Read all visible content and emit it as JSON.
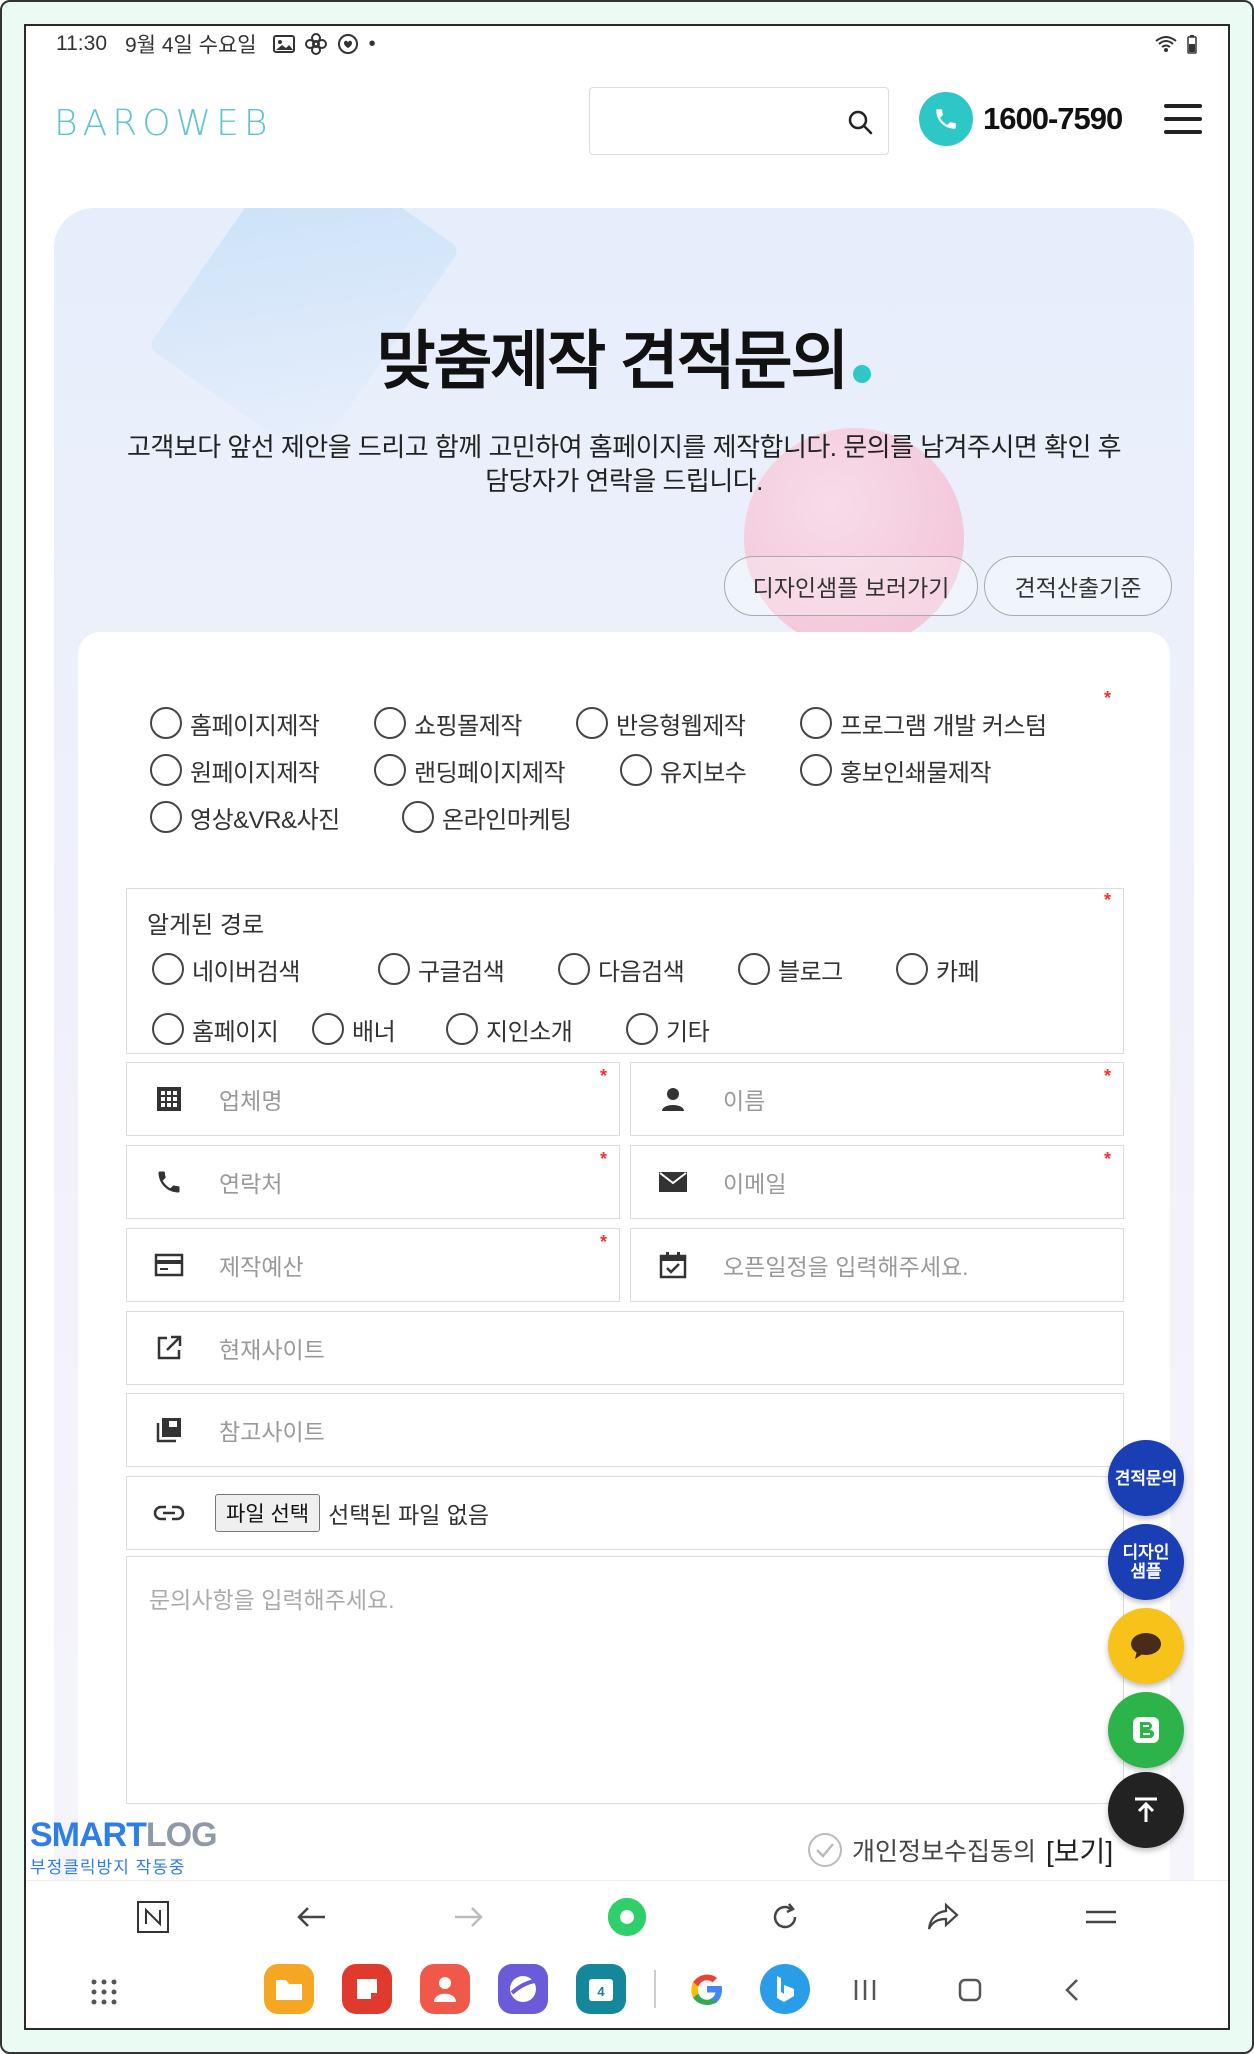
{
  "status_bar": {
    "time": "11:30",
    "date": "9월 4일 수요일",
    "dot": "•"
  },
  "header": {
    "logo": "BAROWEB",
    "phone": "1600-7590"
  },
  "hero": {
    "title": "맞춤제작 견적문의",
    "desc_line1": "고객보다 앞선 제안을 드리고 함께 고민하여 홈페이지를 제작합니다. 문의를 남겨주시면 확인 후",
    "desc_line2": "담당자가 연락을 드립니다.",
    "btn_sample": "디자인샘플 보러가기",
    "btn_criteria": "견적산출기준"
  },
  "form": {
    "required_mark": "*",
    "service_options": [
      "홈페이지제작",
      "쇼핑몰제작",
      "반응형웹제작",
      "프로그램 개발 커스텀",
      "원페이지제작",
      "랜딩페이지제작",
      "유지보수",
      "홍보인쇄물제작",
      "영상&VR&사진",
      "온라인마케팅"
    ],
    "route_title": "알게된 경로",
    "route_options": [
      "네이버검색",
      "구글검색",
      "다음검색",
      "블로그",
      "카페",
      "홈페이지",
      "배너",
      "지인소개",
      "기타"
    ],
    "company_placeholder": "업체명",
    "name_placeholder": "이름",
    "contact_placeholder": "연락처",
    "email_placeholder": "이메일",
    "budget_placeholder": "제작예산",
    "open_date_placeholder": "오픈일정을 입력해주세요.",
    "current_site_placeholder": "현재사이트",
    "reference_site_placeholder": "참고사이트",
    "file_button": "파일 선택",
    "file_status": "선택된 파일 없음",
    "message_placeholder": "문의사항을 입력해주세요.",
    "privacy_label": "개인정보수집동의",
    "privacy_view": "[보기]"
  },
  "fabs": {
    "estimate": "견적문의",
    "design_sample": "디자인\n샘플"
  },
  "smartlog": {
    "title_a": "SMART",
    "title_b": "LOG",
    "subtitle": "부정클릭방지 작동중"
  },
  "colors": {
    "accent": "#2ec7c8",
    "fab_blue": "#1a3fb5",
    "kakao": "#f7c31a",
    "blog_green": "#2cb34a",
    "dark": "#222222",
    "required": "#e33333"
  }
}
